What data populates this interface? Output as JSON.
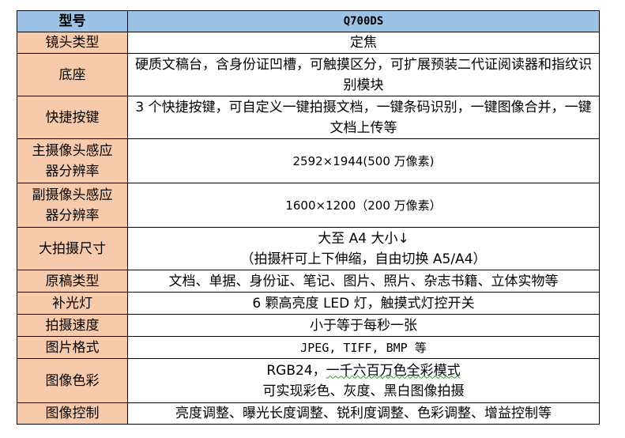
{
  "table": {
    "header": {
      "label": "型号",
      "model": "Q700DS"
    },
    "rows": [
      {
        "label": "镜头类型",
        "value": "定焦"
      },
      {
        "label": "底座",
        "value": "硬质文稿台，含身份证凹槽，可触摸区分，可扩展预装二代证阅读器和指纹识别模块"
      },
      {
        "label": "快捷按键",
        "value": "3 个快捷按键，可自定义一键拍摄文档，一键条码识别，一键图像合并，一键文档上传等"
      },
      {
        "label_line1": "主摄像头感应",
        "label_line2": "器分辨率",
        "value": "2592×1944(500 万像素)"
      },
      {
        "label_line1": "副摄像头感应",
        "label_line2": "器分辨率",
        "value": "1600×1200（200 万像素）"
      },
      {
        "label": "大拍摄尺寸",
        "value_line1": "大至 A4 大小↓",
        "value_line2": "（拍摄杆可上下伸缩，自由切换 A5/A4）"
      },
      {
        "label": "原稿类型",
        "value": "文档、单据、身份证、笔记、图片、照片、杂志书籍、立体实物等"
      },
      {
        "label": "补光灯",
        "value": "6 颗高亮度 LED 灯，触摸式灯控开关"
      },
      {
        "label": "拍摄速度",
        "value": "小于等于每秒一张"
      },
      {
        "label": "图片格式",
        "value": "JPEG, TIFF, BMP 等"
      },
      {
        "label": "图像色彩",
        "value_line1_a": "RGB24，",
        "value_line1_b": "一千六百万色全彩模式",
        "value_line2": "可实现彩色、灰度、黑白图像拍摄"
      },
      {
        "label": "图像控制",
        "value": "亮度调整、曝光长度调整、锐利度调整、色彩调整、增益控制等"
      }
    ]
  }
}
